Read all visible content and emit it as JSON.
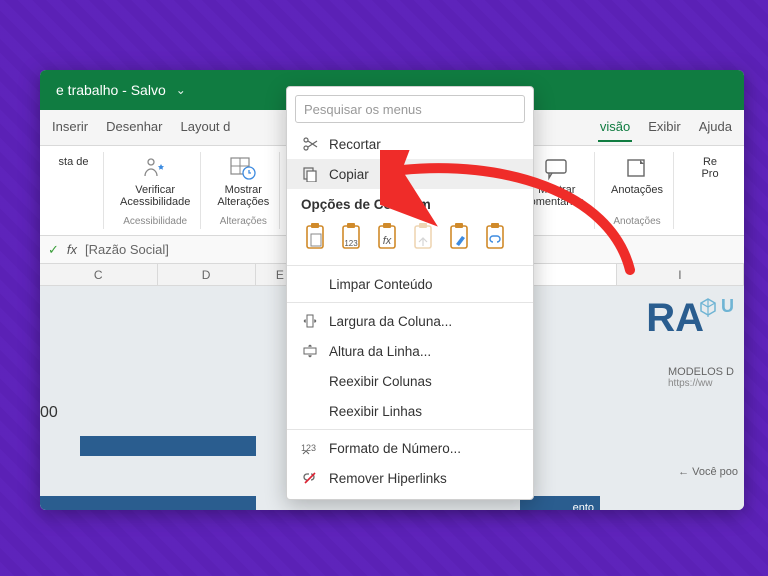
{
  "titlebar": {
    "title": "e trabalho  -  Salvo"
  },
  "ribbonTabs": {
    "items": [
      {
        "label": "Inserir"
      },
      {
        "label": "Desenhar"
      },
      {
        "label": "Layout d"
      },
      {
        "label": "visão"
      },
      {
        "label": "Exibir"
      },
      {
        "label": "Ajuda"
      }
    ]
  },
  "ribbon": {
    "group_sta": {
      "label": "sta de"
    },
    "group_acess": {
      "btn1": "Verificar\nAcessibilidade",
      "label": "Acessibilidade"
    },
    "group_alt": {
      "btn1": "Mostrar\nAlterações",
      "label": "Alterações"
    },
    "group_com": {
      "btn1": "Mostrar\nomentários"
    },
    "group_anot": {
      "btn1": "Anotações",
      "label": "Anotações"
    },
    "group_ret": {
      "btn1": "Re\nPro"
    }
  },
  "formula": {
    "value": "[Razão Social]"
  },
  "cols": [
    "C",
    "D",
    "E",
    "I"
  ],
  "sheet": {
    "big1": "]",
    "big2": "RA",
    "logo_text": "U",
    "modelos1": "MODELOS D",
    "modelos2": "https://ww",
    "num00": "00",
    "voce": "←  Você poo",
    "car": "ento"
  },
  "menu": {
    "search_placeholder": "Pesquisar os menus",
    "cut": "Recortar",
    "copy": "Copiar",
    "paste_header": "Opções de Colagem",
    "clear": "Limpar Conteúdo",
    "colwidth": "Largura da Coluna...",
    "rowheight": "Altura da Linha...",
    "unhide_cols": "Reexibir Colunas",
    "unhide_rows": "Reexibir Linhas",
    "numfmt": "Formato de Número...",
    "rmhyper": "Remover Hiperlinks",
    "paste_icons": [
      "paste-default",
      "paste-values",
      "paste-formulas",
      "paste-transpose",
      "paste-formatting",
      "paste-link"
    ]
  },
  "colors": {
    "accent": "#107c41",
    "arrow": "#ef2c29"
  }
}
